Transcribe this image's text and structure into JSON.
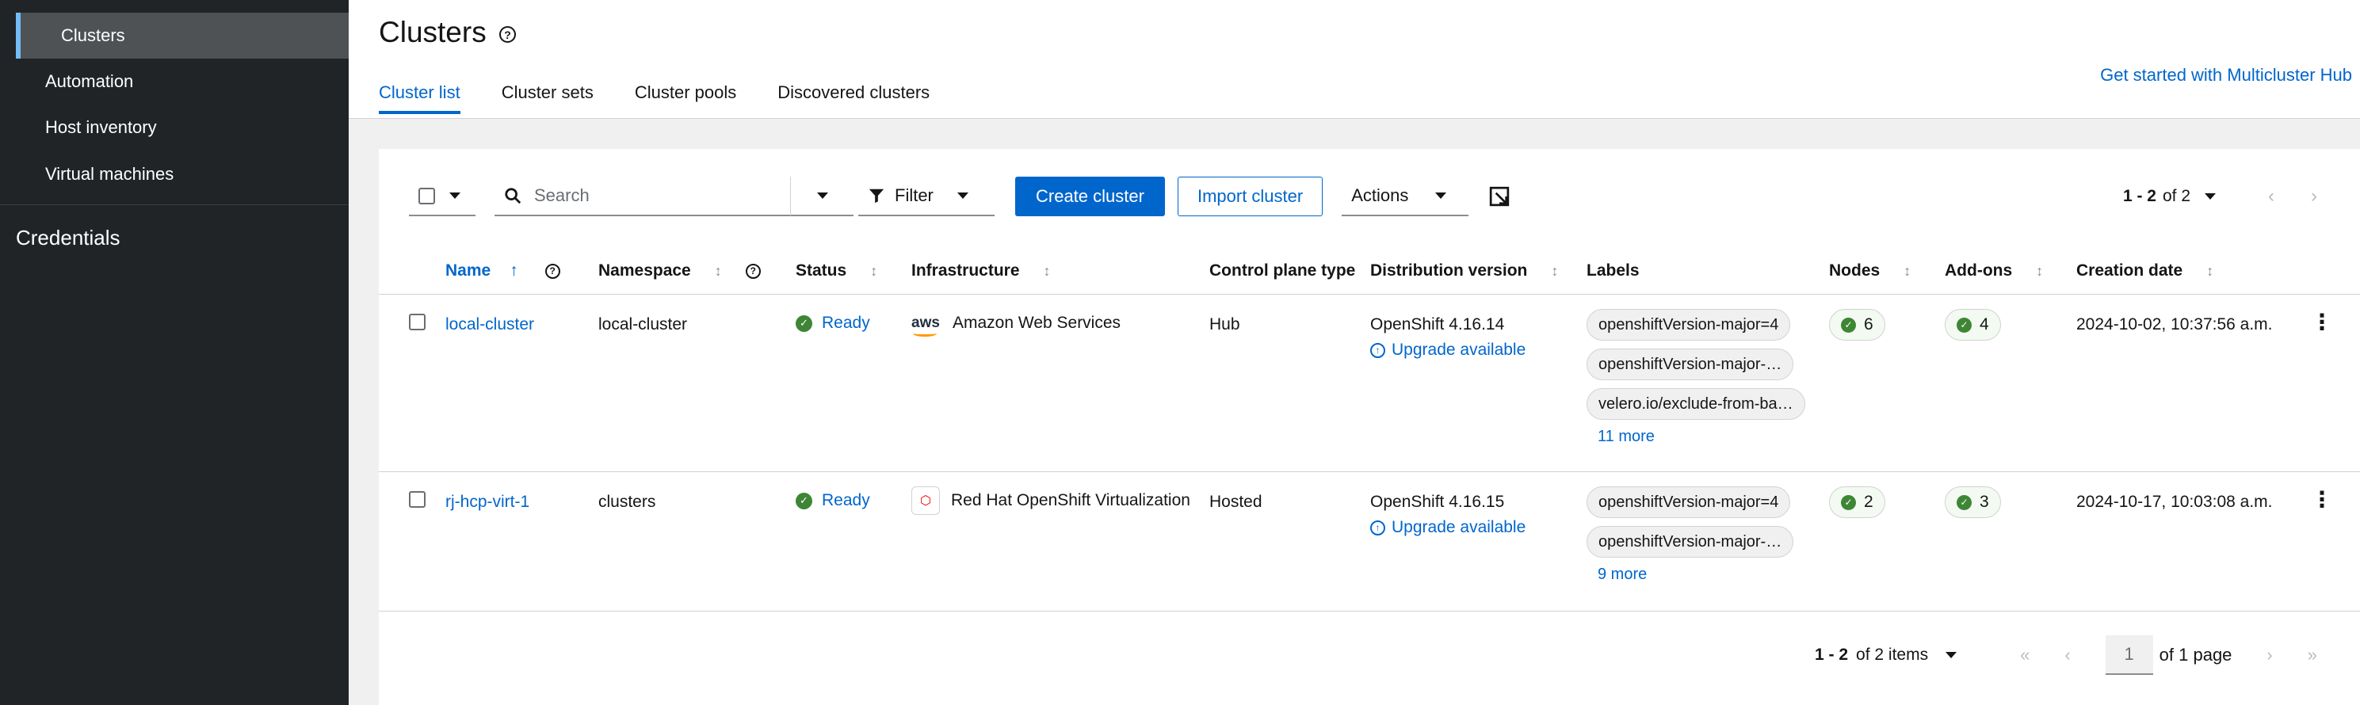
{
  "sidebar": {
    "items": [
      {
        "label": "Clusters"
      },
      {
        "label": "Automation"
      },
      {
        "label": "Host inventory"
      },
      {
        "label": "Virtual machines"
      }
    ],
    "group_label": "Credentials"
  },
  "header": {
    "title": "Clusters",
    "help_glyph": "?",
    "get_started": "Get started with Multicluster Hub",
    "tabs": [
      {
        "label": "Cluster list"
      },
      {
        "label": "Cluster sets"
      },
      {
        "label": "Cluster pools"
      },
      {
        "label": "Discovered clusters"
      }
    ]
  },
  "toolbar": {
    "search_placeholder": "Search",
    "filter_label": "Filter",
    "create_label": "Create cluster",
    "import_label": "Import cluster",
    "actions_label": "Actions",
    "pagination_range": "1 - 2",
    "pagination_of": "of 2"
  },
  "table": {
    "columns": [
      {
        "label": "Name"
      },
      {
        "label": "Namespace"
      },
      {
        "label": "Status"
      },
      {
        "label": "Infrastructure"
      },
      {
        "label": "Control plane type"
      },
      {
        "label": "Distribution version"
      },
      {
        "label": "Labels"
      },
      {
        "label": "Nodes"
      },
      {
        "label": "Add-ons"
      },
      {
        "label": "Creation date"
      }
    ],
    "rows": [
      {
        "name": "local-cluster",
        "namespace": "local-cluster",
        "status": "Ready",
        "infra_logo": "aws",
        "infrastructure": "Amazon Web Services",
        "control_plane": "Hub",
        "version": "OpenShift 4.16.14",
        "upgrade": "Upgrade available",
        "labels": [
          "openshiftVersion-major=4",
          "openshiftVersion-major-…",
          "velero.io/exclude-from-ba…"
        ],
        "more_labels": "11 more",
        "nodes": "6",
        "addons": "4",
        "created": "2024-10-02, 10:37:56 a.m."
      },
      {
        "name": "rj-hcp-virt-1",
        "namespace": "clusters",
        "status": "Ready",
        "infrastructure": "Red Hat OpenShift Virtualization",
        "control_plane": "Hosted",
        "version": "OpenShift 4.16.15",
        "upgrade": "Upgrade available",
        "labels": [
          "openshiftVersion-major=4",
          "openshiftVersion-major-…"
        ],
        "more_labels": "9 more",
        "nodes": "2",
        "addons": "3",
        "created": "2024-10-17, 10:03:08 a.m."
      }
    ]
  },
  "pagination_bottom": {
    "range": "1 - 2",
    "of_items": "of 2 items",
    "page": "1",
    "of_pages": "of 1 page"
  },
  "colors": {
    "accent": "#0066cc",
    "sidebar_bg": "#212427",
    "success": "#3e8635"
  },
  "icons": {
    "nav_prev": "‹",
    "nav_next": "›",
    "nav_first": "«",
    "nav_last": "»",
    "sort_asc": "↑",
    "sort_both": "↕",
    "check": "✓",
    "upgrade": "↑",
    "kebab": "⋮",
    "ocp_glyph": "⬡"
  }
}
